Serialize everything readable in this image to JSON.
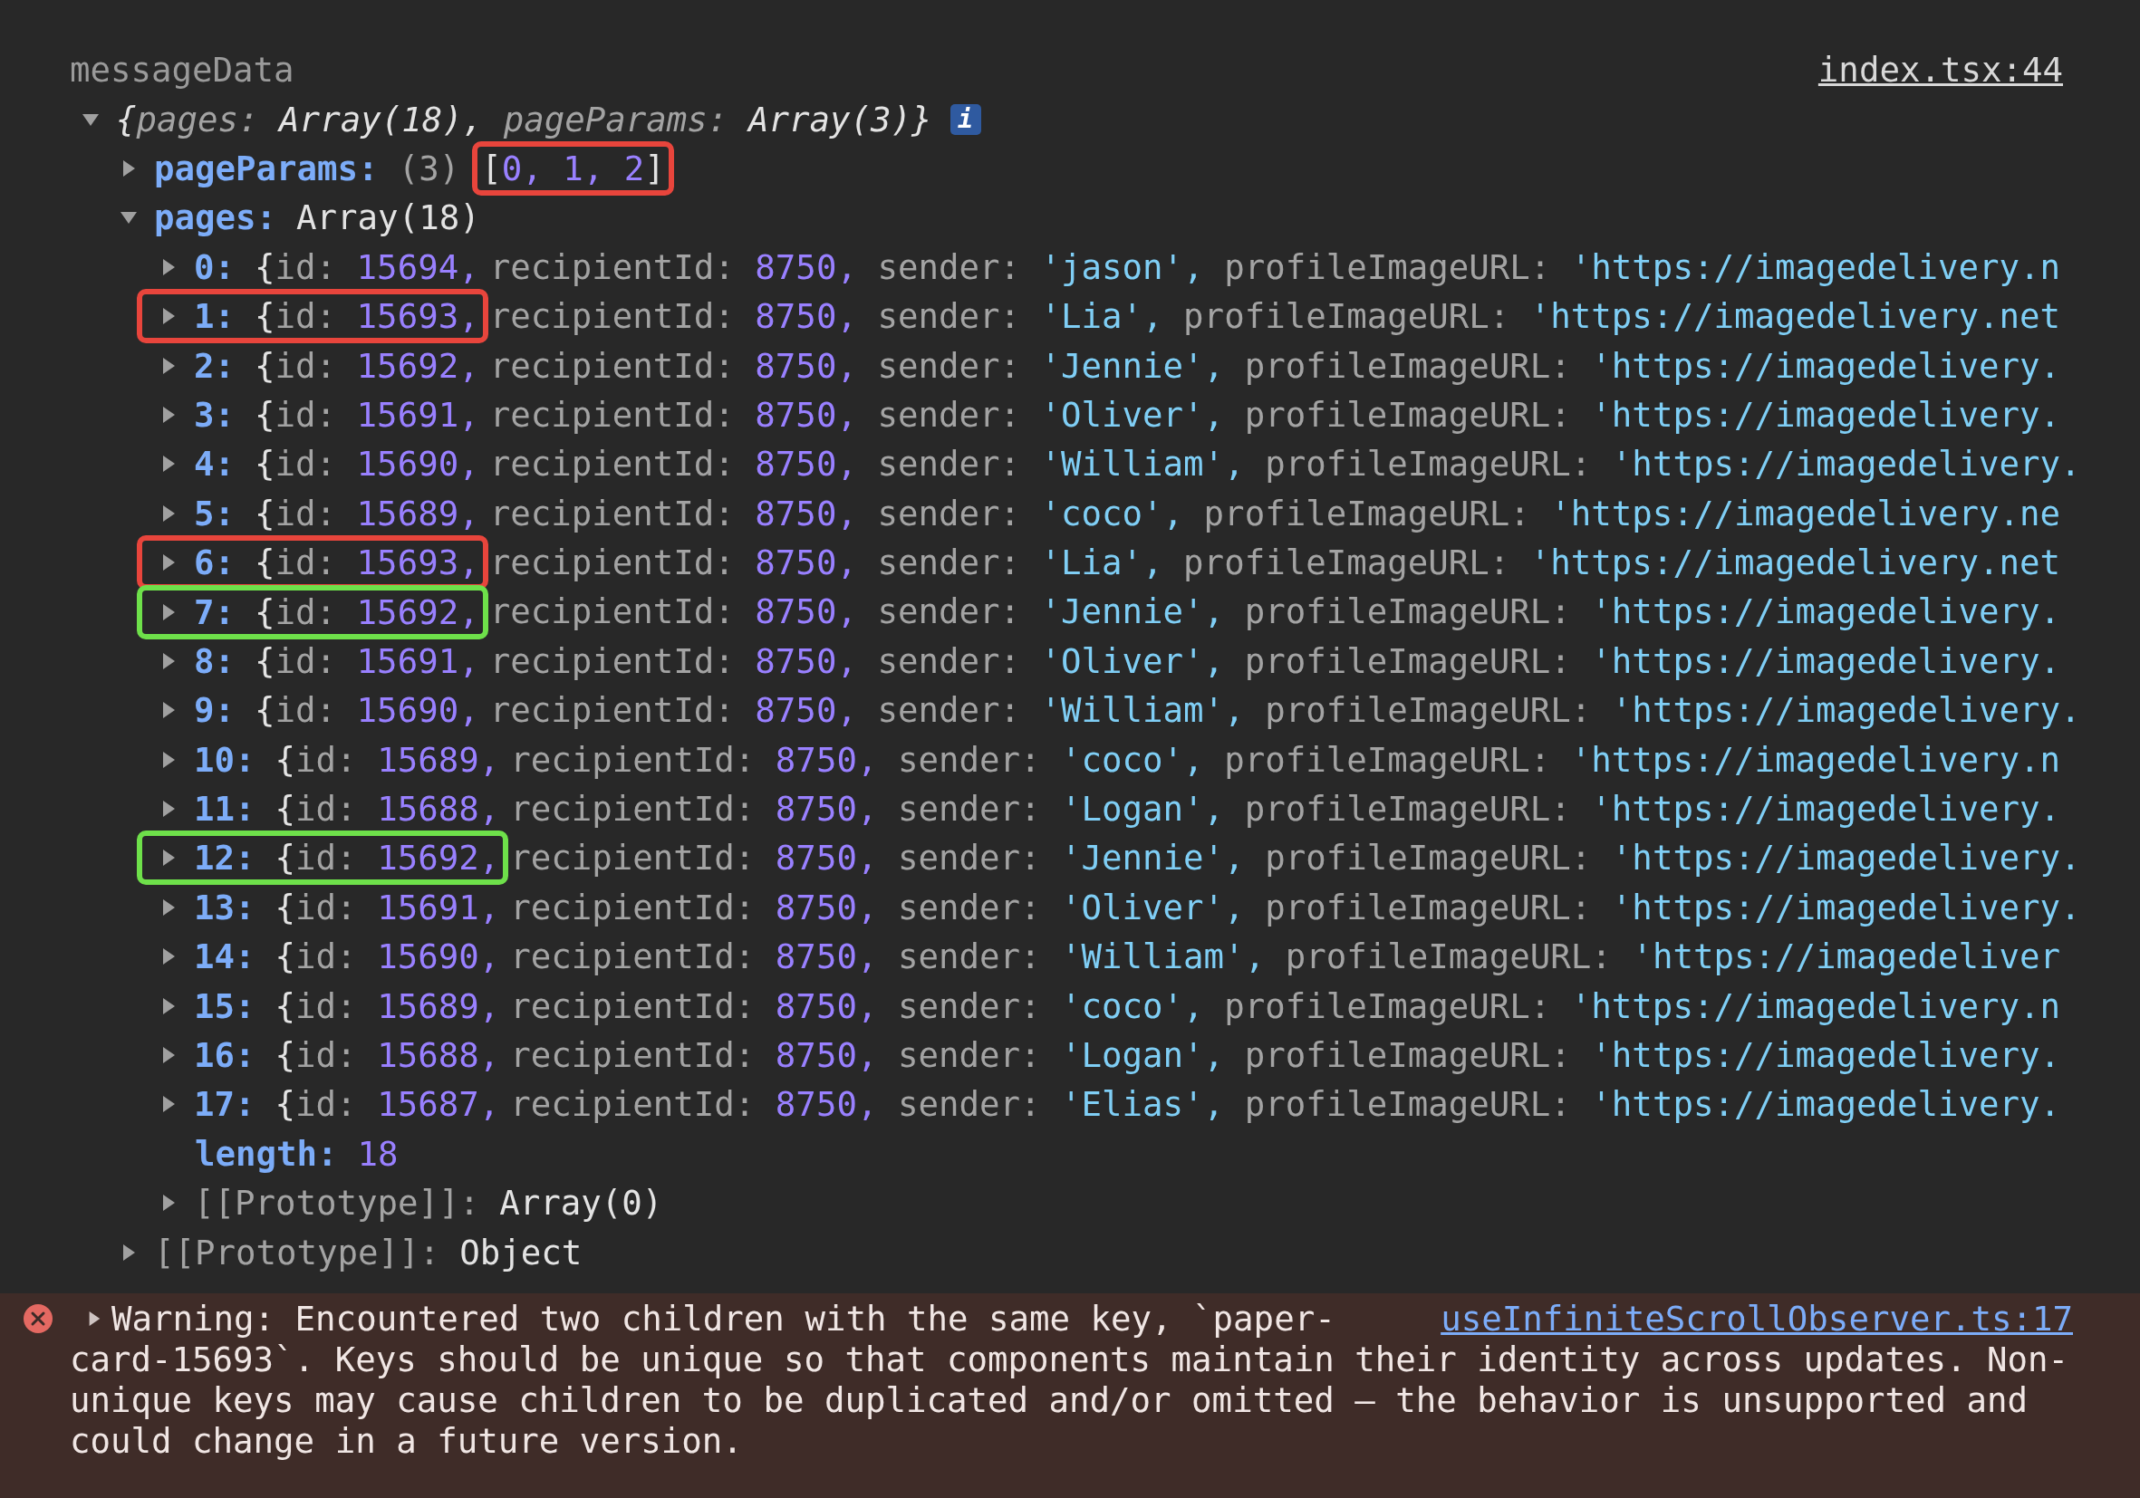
{
  "console_entry": {
    "label": "messageData",
    "source_link": "index.tsx:44",
    "root": {
      "expanded": true,
      "open": "{",
      "preview": [
        {
          "key": "pages:",
          "value": "Array(18),"
        },
        {
          "key": "pageParams:",
          "value": "Array(3)"
        }
      ],
      "close": "}",
      "info_badge": "i"
    },
    "page_params": {
      "expanded": false,
      "key": "pageParams:",
      "count": "(3)",
      "open": "[",
      "values": [
        "0,",
        "1,",
        "2"
      ],
      "close": "]",
      "color": "#e8453c"
    },
    "pages": {
      "expanded": true,
      "key": "pages:",
      "value": "Array(18)",
      "items": [
        {
          "expanded": false,
          "index": "0:",
          "open": "{",
          "fields": [
            {
              "name": "id:",
              "value": "15694,",
              "kind": "number"
            },
            {
              "name": "recipientId:",
              "value": "8750,",
              "kind": "number"
            },
            {
              "name": "sender:",
              "value": "'jason',",
              "kind": "string"
            },
            {
              "name": "profileImageURL:",
              "value": "'https://imagedelivery.n",
              "kind": "string"
            }
          ]
        },
        {
          "expanded": false,
          "index": "1:",
          "open": "{",
          "color": "#e8453c",
          "fields": [
            {
              "name": "id:",
              "value": "15693,",
              "kind": "number"
            },
            {
              "name": "recipientId:",
              "value": "8750,",
              "kind": "number"
            },
            {
              "name": "sender:",
              "value": "'Lia',",
              "kind": "string"
            },
            {
              "name": "profileImageURL:",
              "value": "'https://imagedelivery.net",
              "kind": "string"
            }
          ]
        },
        {
          "expanded": false,
          "index": "2:",
          "open": "{",
          "fields": [
            {
              "name": "id:",
              "value": "15692,",
              "kind": "number"
            },
            {
              "name": "recipientId:",
              "value": "8750,",
              "kind": "number"
            },
            {
              "name": "sender:",
              "value": "'Jennie',",
              "kind": "string"
            },
            {
              "name": "profileImageURL:",
              "value": "'https://imagedelivery.",
              "kind": "string"
            }
          ]
        },
        {
          "expanded": false,
          "index": "3:",
          "open": "{",
          "fields": [
            {
              "name": "id:",
              "value": "15691,",
              "kind": "number"
            },
            {
              "name": "recipientId:",
              "value": "8750,",
              "kind": "number"
            },
            {
              "name": "sender:",
              "value": "'Oliver',",
              "kind": "string"
            },
            {
              "name": "profileImageURL:",
              "value": "'https://imagedelivery.",
              "kind": "string"
            }
          ]
        },
        {
          "expanded": false,
          "index": "4:",
          "open": "{",
          "fields": [
            {
              "name": "id:",
              "value": "15690,",
              "kind": "number"
            },
            {
              "name": "recipientId:",
              "value": "8750,",
              "kind": "number"
            },
            {
              "name": "sender:",
              "value": "'William',",
              "kind": "string"
            },
            {
              "name": "profileImageURL:",
              "value": "'https://imagedelivery.",
              "kind": "string"
            }
          ]
        },
        {
          "expanded": false,
          "index": "5:",
          "open": "{",
          "fields": [
            {
              "name": "id:",
              "value": "15689,",
              "kind": "number"
            },
            {
              "name": "recipientId:",
              "value": "8750,",
              "kind": "number"
            },
            {
              "name": "sender:",
              "value": "'coco',",
              "kind": "string"
            },
            {
              "name": "profileImageURL:",
              "value": "'https://imagedelivery.ne",
              "kind": "string"
            }
          ]
        },
        {
          "expanded": false,
          "index": "6:",
          "open": "{",
          "color": "#e8453c",
          "fields": [
            {
              "name": "id:",
              "value": "15693,",
              "kind": "number"
            },
            {
              "name": "recipientId:",
              "value": "8750,",
              "kind": "number"
            },
            {
              "name": "sender:",
              "value": "'Lia',",
              "kind": "string"
            },
            {
              "name": "profileImageURL:",
              "value": "'https://imagedelivery.net",
              "kind": "string"
            }
          ]
        },
        {
          "expanded": false,
          "index": "7:",
          "open": "{",
          "color": "#6ee04a",
          "fields": [
            {
              "name": "id:",
              "value": "15692,",
              "kind": "number"
            },
            {
              "name": "recipientId:",
              "value": "8750,",
              "kind": "number"
            },
            {
              "name": "sender:",
              "value": "'Jennie',",
              "kind": "string"
            },
            {
              "name": "profileImageURL:",
              "value": "'https://imagedelivery.",
              "kind": "string"
            }
          ]
        },
        {
          "expanded": false,
          "index": "8:",
          "open": "{",
          "fields": [
            {
              "name": "id:",
              "value": "15691,",
              "kind": "number"
            },
            {
              "name": "recipientId:",
              "value": "8750,",
              "kind": "number"
            },
            {
              "name": "sender:",
              "value": "'Oliver',",
              "kind": "string"
            },
            {
              "name": "profileImageURL:",
              "value": "'https://imagedelivery.",
              "kind": "string"
            }
          ]
        },
        {
          "expanded": false,
          "index": "9:",
          "open": "{",
          "fields": [
            {
              "name": "id:",
              "value": "15690,",
              "kind": "number"
            },
            {
              "name": "recipientId:",
              "value": "8750,",
              "kind": "number"
            },
            {
              "name": "sender:",
              "value": "'William',",
              "kind": "string"
            },
            {
              "name": "profileImageURL:",
              "value": "'https://imagedelivery.",
              "kind": "string"
            }
          ]
        },
        {
          "expanded": false,
          "index": "10:",
          "open": "{",
          "fields": [
            {
              "name": "id:",
              "value": "15689,",
              "kind": "number"
            },
            {
              "name": "recipientId:",
              "value": "8750,",
              "kind": "number"
            },
            {
              "name": "sender:",
              "value": "'coco',",
              "kind": "string"
            },
            {
              "name": "profileImageURL:",
              "value": "'https://imagedelivery.n",
              "kind": "string"
            }
          ]
        },
        {
          "expanded": false,
          "index": "11:",
          "open": "{",
          "fields": [
            {
              "name": "id:",
              "value": "15688,",
              "kind": "number"
            },
            {
              "name": "recipientId:",
              "value": "8750,",
              "kind": "number"
            },
            {
              "name": "sender:",
              "value": "'Logan',",
              "kind": "string"
            },
            {
              "name": "profileImageURL:",
              "value": "'https://imagedelivery.",
              "kind": "string"
            }
          ]
        },
        {
          "expanded": false,
          "index": "12:",
          "open": "{",
          "color": "#6ee04a",
          "fields": [
            {
              "name": "id:",
              "value": "15692,",
              "kind": "number"
            },
            {
              "name": "recipientId:",
              "value": "8750,",
              "kind": "number"
            },
            {
              "name": "sender:",
              "value": "'Jennie',",
              "kind": "string"
            },
            {
              "name": "profileImageURL:",
              "value": "'https://imagedelivery.",
              "kind": "string"
            }
          ]
        },
        {
          "expanded": false,
          "index": "13:",
          "open": "{",
          "fields": [
            {
              "name": "id:",
              "value": "15691,",
              "kind": "number"
            },
            {
              "name": "recipientId:",
              "value": "8750,",
              "kind": "number"
            },
            {
              "name": "sender:",
              "value": "'Oliver',",
              "kind": "string"
            },
            {
              "name": "profileImageURL:",
              "value": "'https://imagedelivery.",
              "kind": "string"
            }
          ]
        },
        {
          "expanded": false,
          "index": "14:",
          "open": "{",
          "fields": [
            {
              "name": "id:",
              "value": "15690,",
              "kind": "number"
            },
            {
              "name": "recipientId:",
              "value": "8750,",
              "kind": "number"
            },
            {
              "name": "sender:",
              "value": "'William',",
              "kind": "string"
            },
            {
              "name": "profileImageURL:",
              "value": "'https://imagedeliver",
              "kind": "string"
            }
          ]
        },
        {
          "expanded": false,
          "index": "15:",
          "open": "{",
          "fields": [
            {
              "name": "id:",
              "value": "15689,",
              "kind": "number"
            },
            {
              "name": "recipientId:",
              "value": "8750,",
              "kind": "number"
            },
            {
              "name": "sender:",
              "value": "'coco',",
              "kind": "string"
            },
            {
              "name": "profileImageURL:",
              "value": "'https://imagedelivery.n",
              "kind": "string"
            }
          ]
        },
        {
          "expanded": false,
          "index": "16:",
          "open": "{",
          "fields": [
            {
              "name": "id:",
              "value": "15688,",
              "kind": "number"
            },
            {
              "name": "recipientId:",
              "value": "8750,",
              "kind": "number"
            },
            {
              "name": "sender:",
              "value": "'Logan',",
              "kind": "string"
            },
            {
              "name": "profileImageURL:",
              "value": "'https://imagedelivery.",
              "kind": "string"
            }
          ]
        },
        {
          "expanded": false,
          "index": "17:",
          "open": "{",
          "fields": [
            {
              "name": "id:",
              "value": "15687,",
              "kind": "number"
            },
            {
              "name": "recipientId:",
              "value": "8750,",
              "kind": "number"
            },
            {
              "name": "sender:",
              "value": "'Elias',",
              "kind": "string"
            },
            {
              "name": "profileImageURL:",
              "value": "'https://imagedelivery.",
              "kind": "string"
            }
          ]
        }
      ],
      "length": {
        "key": "length:",
        "value": "18"
      },
      "prototype": {
        "expanded": false,
        "key": "[[Prototype]]:",
        "value": "Array(0)"
      }
    },
    "prototype": {
      "expanded": false,
      "key": "[[Prototype]]:",
      "value": "Object"
    }
  },
  "warning": {
    "expanded": false,
    "message_lines": [
      "Warning: Encountered two children with the same key, `paper-",
      "card-15693`. Keys should be unique so that components maintain their identity across updates. Non-",
      "unique keys may cause children to be duplicated and/or omitted — the behavior is unsupported and",
      "could change in a future version."
    ],
    "source_link": "useInfiniteScrollObserver.ts:17"
  }
}
